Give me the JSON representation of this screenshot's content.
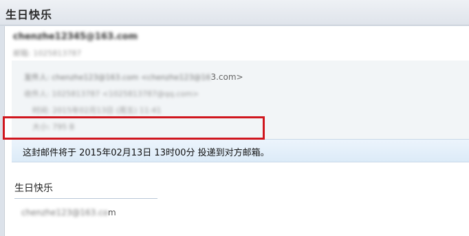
{
  "window": {
    "title": "生日快乐"
  },
  "header": {
    "sender": "chenzhe12345@163.com",
    "account": "邮箱: 1025813787"
  },
  "meta": {
    "from_blurred": "发件人: chenzhe123@163.com <chenzhe123@16",
    "from_tail": "3.com>",
    "to": "收件人: 1025813787 <1025813787@qq.com>",
    "time": "时间: 2015年02月13日 (周五) 11:41",
    "size": "大小: 795 B"
  },
  "notice": {
    "text": "这封邮件将于 2015年02月13日 13时00分 投递到对方邮箱。"
  },
  "content": {
    "subject": "生日快乐",
    "body_blurred": "chenzhe123@163.co",
    "body_tail": "m"
  }
}
